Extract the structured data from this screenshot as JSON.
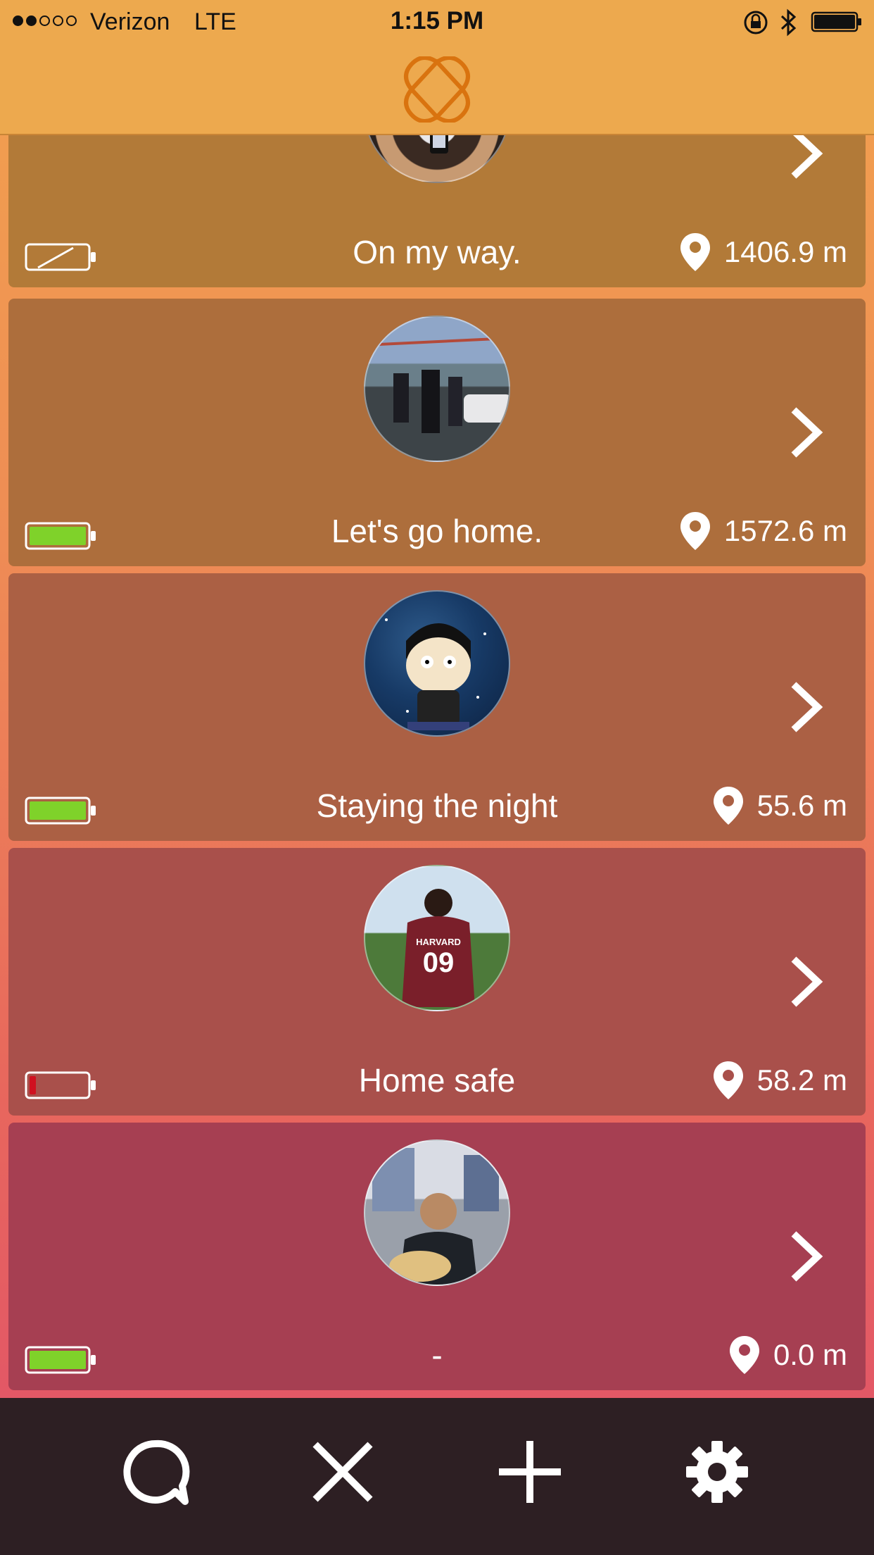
{
  "status_bar": {
    "carrier": "Verizon",
    "network": "LTE",
    "time": "1:15 PM",
    "icons": [
      "signal-dots",
      "rotation-lock-icon",
      "bluetooth-icon",
      "battery-icon"
    ]
  },
  "header": {
    "logo_icon": "interlocking-rings-logo",
    "accent": "#d9730f"
  },
  "friends": [
    {
      "message": "On my way.",
      "distance": "1406.9 m",
      "battery": "charging-empty",
      "card_color": "#b27a38",
      "avatar": "person-holding-phone-photo"
    },
    {
      "message": "Let's go home.",
      "distance": "1572.6 m",
      "battery": "full",
      "card_color": "#ad6e3c",
      "avatar": "group-on-bridge-photo"
    },
    {
      "message": "Staying the night",
      "distance": "55.6 m",
      "battery": "full",
      "card_color": "#ab6044",
      "avatar": "cartoon-character-avatar"
    },
    {
      "message": "Home safe",
      "distance": "58.2 m",
      "battery": "low",
      "card_color": "#a9504b",
      "avatar": "harvard-09-jersey-photo"
    },
    {
      "message": "-",
      "distance": "0.0 m",
      "battery": "full",
      "card_color": "#a63f52",
      "avatar": "person-at-home-photo"
    }
  ],
  "tab_bar": {
    "items": [
      "chat-icon",
      "close-icon",
      "add-icon",
      "settings-icon"
    ],
    "bg": "#2d1f23"
  }
}
